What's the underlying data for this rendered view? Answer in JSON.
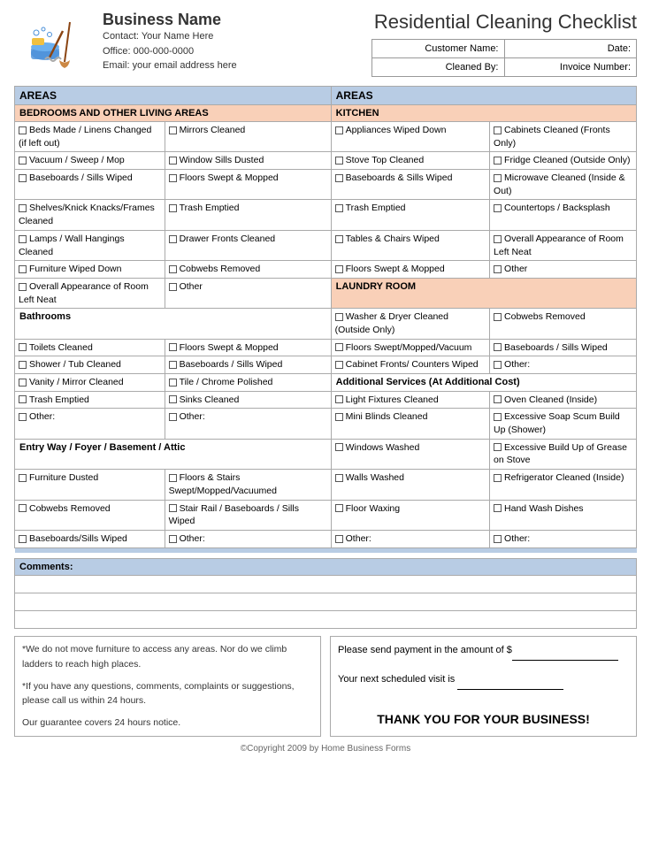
{
  "header": {
    "business_name": "Business Name",
    "contact": "Contact:  Your Name Here",
    "office": "Office:  000-000-0000",
    "email": "Email:  your email address here",
    "main_title": "Residential Cleaning Checklist",
    "customer_name_label": "Customer Name:",
    "date_label": "Date:",
    "cleaned_by_label": "Cleaned By:",
    "invoice_label": "Invoice Number:"
  },
  "areas_label": "AREAS",
  "sections": {
    "bedrooms": {
      "title": "BEDROOMS AND OTHER LIVING AREAS",
      "items_col1": [
        "Beds Made / Linens Changed (if left out)",
        "Vacuum / Sweep / Mop",
        "Baseboards / Sills Wiped",
        "Shelves/Knick Knacks/Frames Cleaned",
        "Lamps / Wall Hangings Cleaned",
        "Furniture Wiped Down",
        "Overall Appearance of Room Left Neat"
      ],
      "items_col2": [
        "Mirrors Cleaned",
        "Window Sills Dusted",
        "Floors Swept & Mopped",
        "Trash Emptied",
        "Drawer Fronts Cleaned",
        "Cobwebs Removed",
        "Other"
      ]
    },
    "kitchen": {
      "title": "KITCHEN",
      "items_col1": [
        "Appliances Wiped Down",
        "Stove Top Cleaned",
        "Baseboards & Sills Wiped",
        "Trash Emptied",
        "Tables & Chairs Wiped",
        "Floors Swept & Mopped"
      ],
      "items_col2": [
        "Cabinets Cleaned (Fronts Only)",
        "Fridge Cleaned (Outside Only)",
        "Microwave Cleaned (Inside & Out)",
        "Countertops / Backsplash",
        "Overall Appearance of Room Left Neat",
        "Other"
      ]
    },
    "bathrooms": {
      "title": "Bathrooms",
      "items_col1": [
        "Toilets Cleaned",
        "Shower / Tub Cleaned",
        "Vanity / Mirror Cleaned",
        "Trash Emptied",
        "Other:"
      ],
      "items_col2": [
        "Floors Swept & Mopped",
        "Baseboards / Sills Wiped",
        "Tile / Chrome Polished",
        "Sinks Cleaned",
        "Other:"
      ]
    },
    "laundry": {
      "title": "LAUNDRY ROOM",
      "items_col1": [
        "Washer & Dryer Cleaned (Outside Only)",
        "Floors Swept/Mopped/Vacuum",
        "Cabinet Fronts/ Counters Wiped"
      ],
      "items_col2": [
        "Cobwebs Removed",
        "Baseboards / Sills Wiped",
        "Other:"
      ]
    },
    "entryway": {
      "title": "Entry Way / Foyer / Basement / Attic",
      "items_col1": [
        "Furniture Dusted",
        "Cobwebs Removed",
        "Baseboards/Sills Wiped"
      ],
      "items_col2": [
        "Floors & Stairs Swept/Mopped/Vacuumed",
        "Stair Rail / Baseboards / Sills Wiped",
        "Other:"
      ]
    },
    "additional": {
      "title": "Additional Services (At Additional Cost)",
      "items_col1": [
        "Light Fixtures Cleaned",
        "Mini Blinds Cleaned",
        "Windows Washed",
        "Walls Washed",
        "Floor Waxing",
        "Other:"
      ],
      "items_col2": [
        "Oven Cleaned (Inside)",
        "Excessive Soap Scum Build Up (Shower)",
        "Excessive Build Up of Grease on Stove",
        "Refrigerator Cleaned (Inside)",
        "Hand Wash Dishes",
        "Other:"
      ]
    }
  },
  "comments": {
    "label": "Comments:"
  },
  "footer": {
    "note1": "*We do not move furniture to access any areas.  Nor do we climb ladders to reach high places.",
    "note2": "*If you have any questions, comments, complaints or suggestions, please call us within 24 hours.",
    "note3": "Our guarantee covers 24 hours notice.",
    "payment_text": "Please send payment in the amount of $",
    "visit_text": "Your next scheduled visit is",
    "thank_you": "THANK YOU FOR YOUR BUSINESS!",
    "copyright": "©Copyright 2009 by Home Business Forms"
  }
}
